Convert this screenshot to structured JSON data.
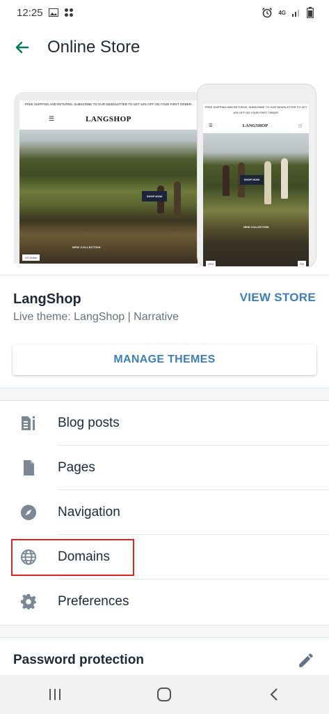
{
  "status_bar": {
    "time": "12:25",
    "network": "4G"
  },
  "app_bar": {
    "title": "Online Store"
  },
  "preview": {
    "promo_text": "FREE SHIPPING AND RETURNS. SUBSCRIBE TO OUR NEWSLETTER TO GET 10% OFF ON YOUR FIRST ORDER.",
    "shop_logo": "LANGSHOP",
    "shop_now": "SHOP NOW",
    "collection": "NEW COLLECTION",
    "currency": "US Dollar",
    "phone_currency": "USD",
    "phone_language": "EN"
  },
  "store": {
    "name": "LangShop",
    "theme": "Live theme: LangShop | Narrative",
    "view_store": "VIEW STORE",
    "manage_themes": "MANAGE THEMES"
  },
  "menu": {
    "items": [
      {
        "label": "Blog posts",
        "icon": "blog-posts-icon"
      },
      {
        "label": "Pages",
        "icon": "page-icon"
      },
      {
        "label": "Navigation",
        "icon": "compass-icon"
      },
      {
        "label": "Domains",
        "icon": "globe-icon"
      },
      {
        "label": "Preferences",
        "icon": "gear-icon"
      }
    ]
  },
  "password": {
    "title": "Password protection"
  },
  "colors": {
    "accent": "#3f7fb3",
    "back_arrow": "#007a5c",
    "highlight": "#e1211f"
  }
}
